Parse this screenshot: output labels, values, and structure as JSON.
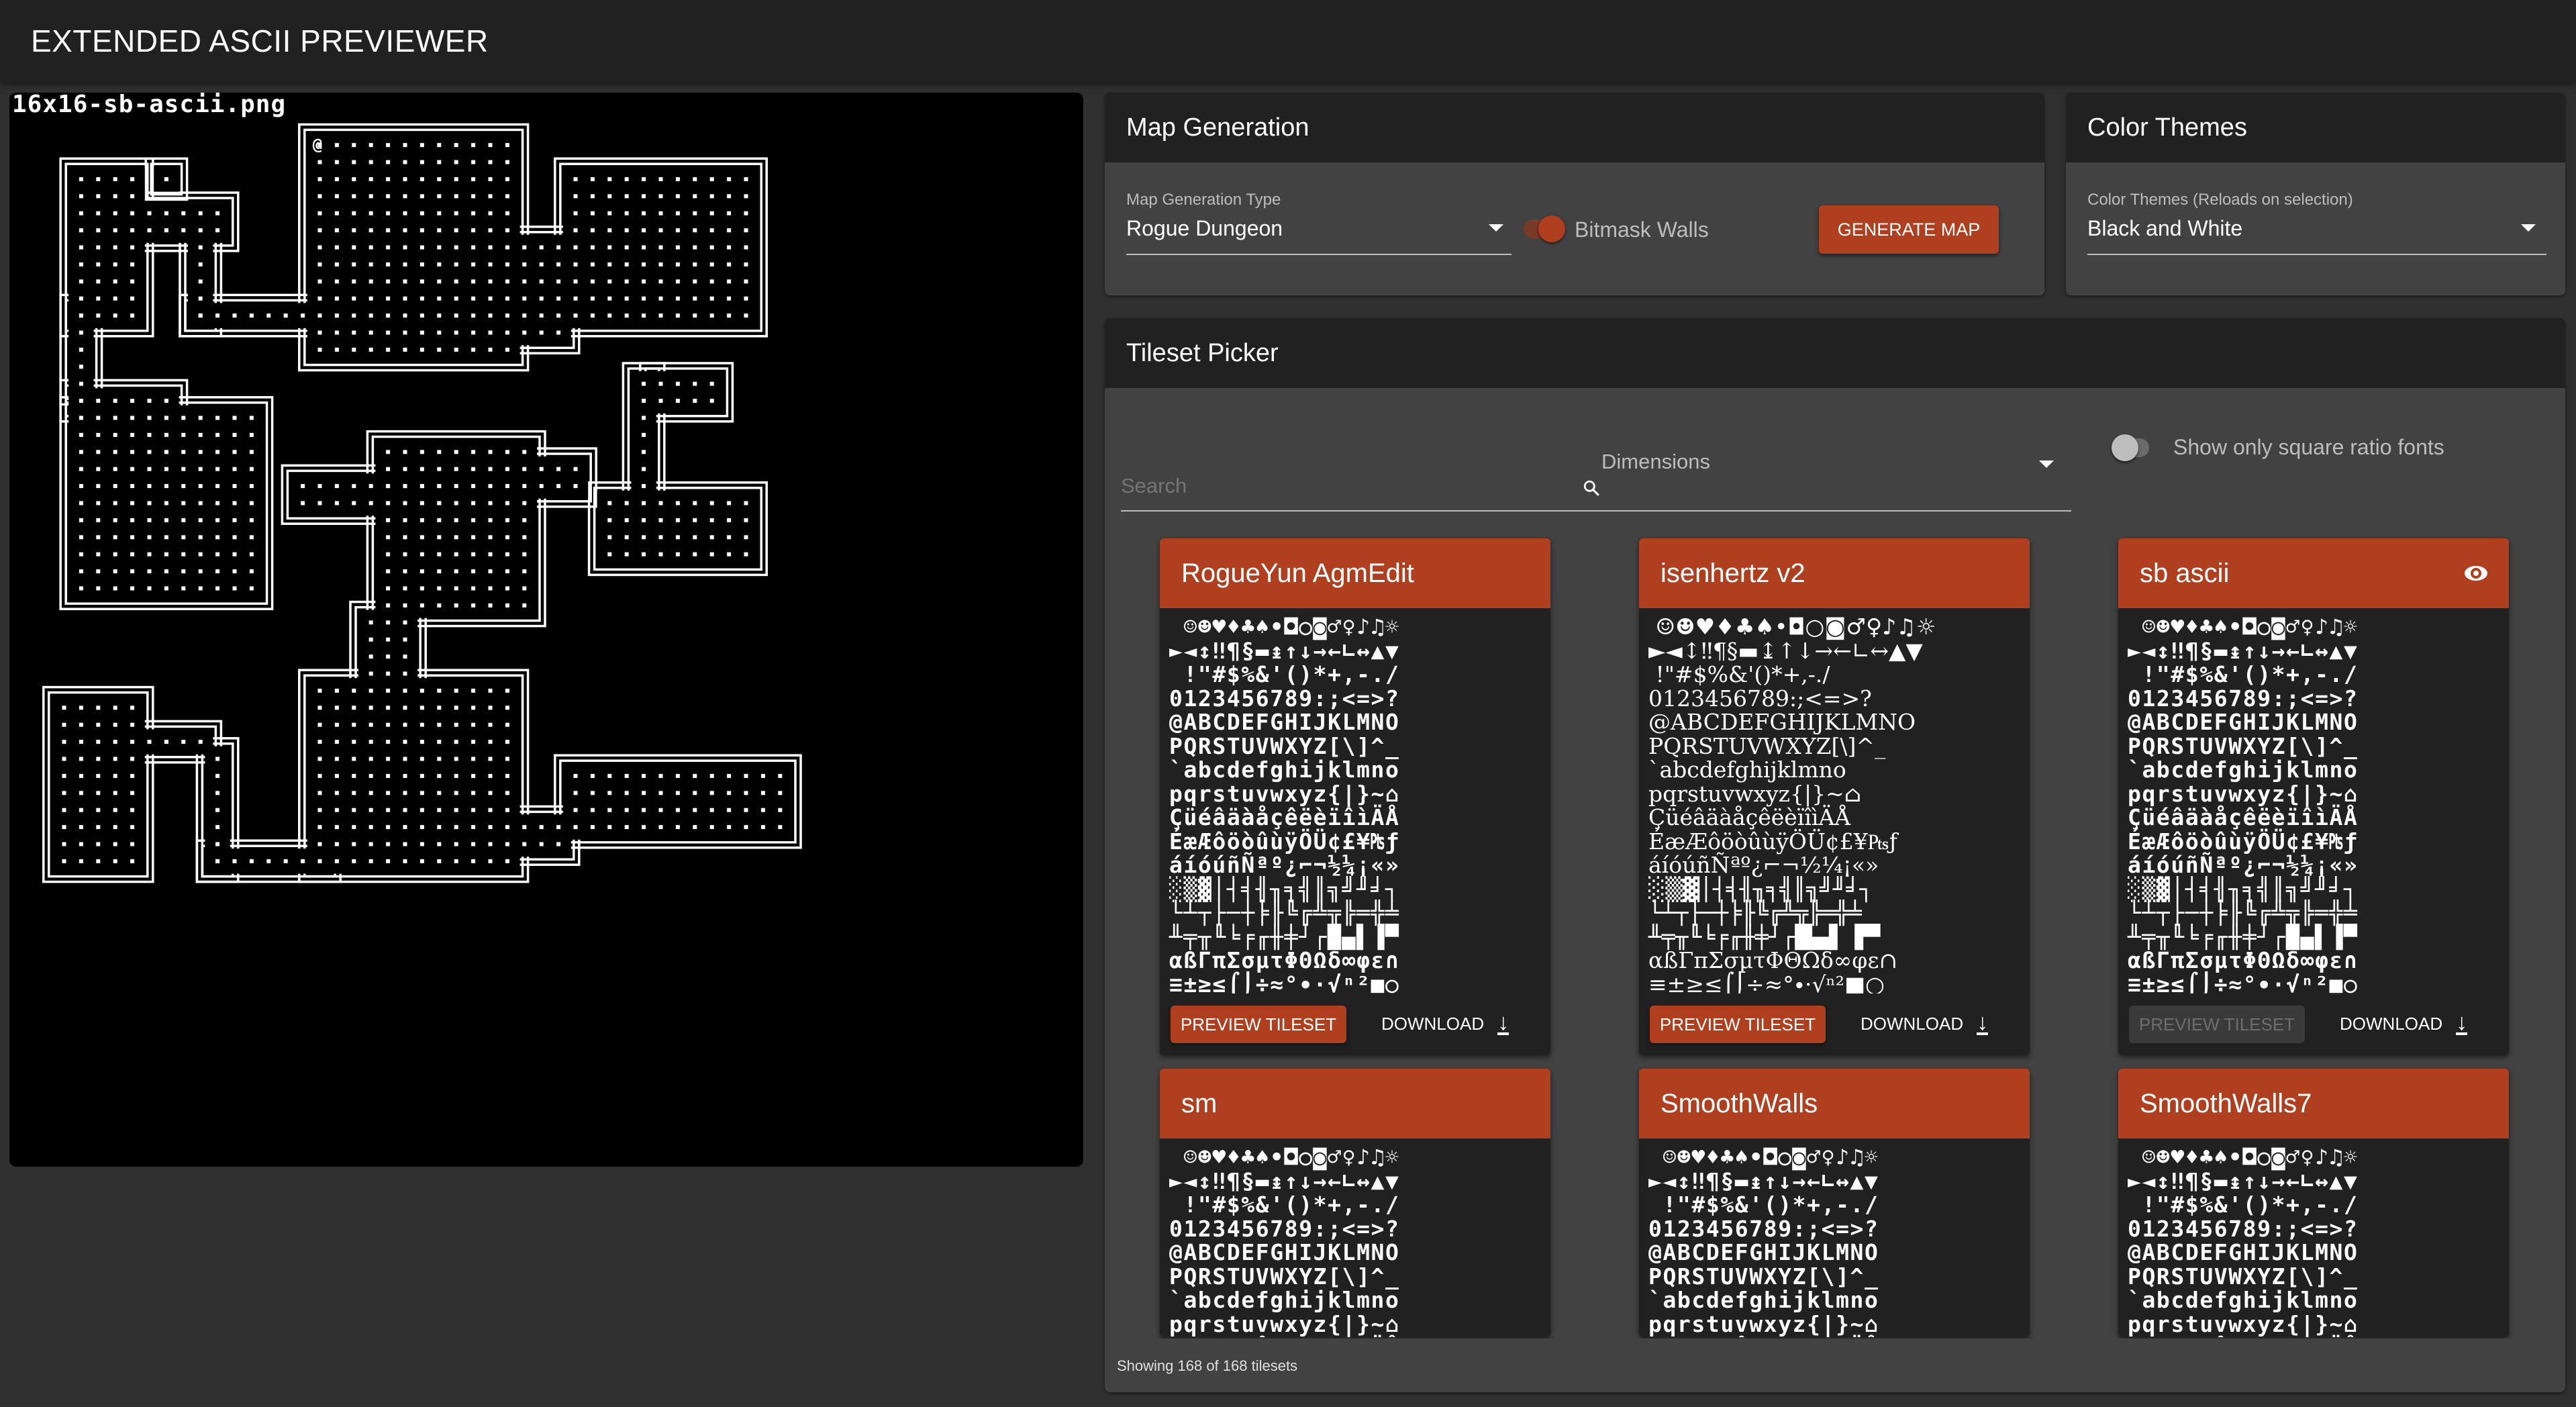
{
  "app": {
    "title": "EXTENDED ASCII PREVIEWER"
  },
  "preview": {
    "filename": "16x16-sb-ascii.png",
    "player_glyph": "@",
    "floor_glyph": "·"
  },
  "map_generation": {
    "title": "Map Generation",
    "type_label": "Map Generation Type",
    "type_value": "Rogue Dungeon",
    "bitmask_label": "Bitmask Walls",
    "bitmask_on": true,
    "generate_label": "GENERATE MAP"
  },
  "color_themes": {
    "title": "Color Themes",
    "label": "Color Themes (Reloads on selection)",
    "value": "Black and White"
  },
  "tileset_picker": {
    "title": "Tileset Picker",
    "search_placeholder": "Search",
    "dimensions_label": "Dimensions",
    "square_label": "Show only square ratio fonts",
    "square_on": false,
    "footer": "Showing 168 of 168 tilesets",
    "preview_label": "PREVIEW TILESET",
    "download_label": "DOWNLOAD",
    "tiles": [
      {
        "name": "RogueYun AgmEdit",
        "selected": false
      },
      {
        "name": "isenhertz v2",
        "selected": false
      },
      {
        "name": "sb ascii",
        "selected": true
      },
      {
        "name": "sm",
        "selected": false
      },
      {
        "name": "SmoothWalls",
        "selected": false
      },
      {
        "name": "SmoothWalls7",
        "selected": false
      }
    ],
    "glyph_rows": [
      " ☺☻♥♦♣♠•◘○◙♂♀♪♫☼",
      "►◄↕‼¶§▬↨↑↓→←∟↔▲▼",
      " !\"#$%&'()*+,-./",
      "0123456789:;<=>?",
      "@ABCDEFGHIJKLMNO",
      "PQRSTUVWXYZ[\\]^_",
      "`abcdefghijklmno",
      "pqrstuvwxyz{|}~⌂",
      "ÇüéâäàåçêëèïîìÄÅ",
      "ÉæÆôöòûùÿÖÜ¢£¥₧ƒ",
      "áíóúñÑªº¿⌐¬½¼¡«»",
      "░▒▓│┤╡╢╖╕╣║╗╝╜╛┐",
      "└┴┬├─┼╞╟╚╔╩╦╠═╬╧",
      "╨╤╥╙╘╒╓╫╪┘┌█▄▌▐▀",
      "αßΓπΣσµτΦΘΩδ∞φε∩",
      "≡±≥≤⌠⌡÷≈°∙·√ⁿ²■○"
    ]
  },
  "colors": {
    "accent": "#b03f20",
    "appbar": "#212121",
    "panel": "#424242",
    "background": "#303030"
  }
}
